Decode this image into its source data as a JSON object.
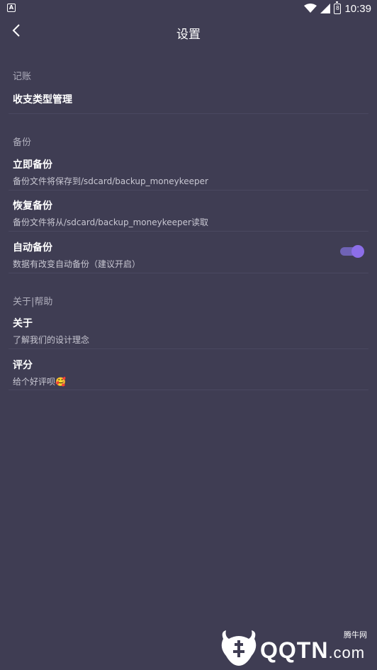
{
  "status_bar": {
    "time": "10:39",
    "notif_glyph": "A",
    "battery_glyph": "8"
  },
  "header": {
    "title": "设置"
  },
  "sections": [
    {
      "header": "记账",
      "items": [
        {
          "title": "收支类型管理",
          "subtitle": ""
        }
      ]
    },
    {
      "header": "备份",
      "items": [
        {
          "title": "立即备份",
          "subtitle": "备份文件将保存到/sdcard/backup_moneykeeper"
        },
        {
          "title": "恢复备份",
          "subtitle": "备份文件将从/sdcard/backup_moneykeeper读取"
        },
        {
          "title": "自动备份",
          "subtitle": "数据有改变自动备份（建议开启）",
          "toggle_on": true
        }
      ]
    },
    {
      "header": "关于|帮助",
      "items": [
        {
          "title": "关于",
          "subtitle": "了解我们的设计理念"
        },
        {
          "title": "评分",
          "subtitle": "给个好评呗🥰"
        }
      ]
    }
  ],
  "watermark": {
    "text": "QQTN",
    "suffix": ".com",
    "tag": "腾牛网"
  },
  "colors": {
    "background": "#3f3d53",
    "accent": "#8c6ee8",
    "divider": "#4a4860"
  }
}
